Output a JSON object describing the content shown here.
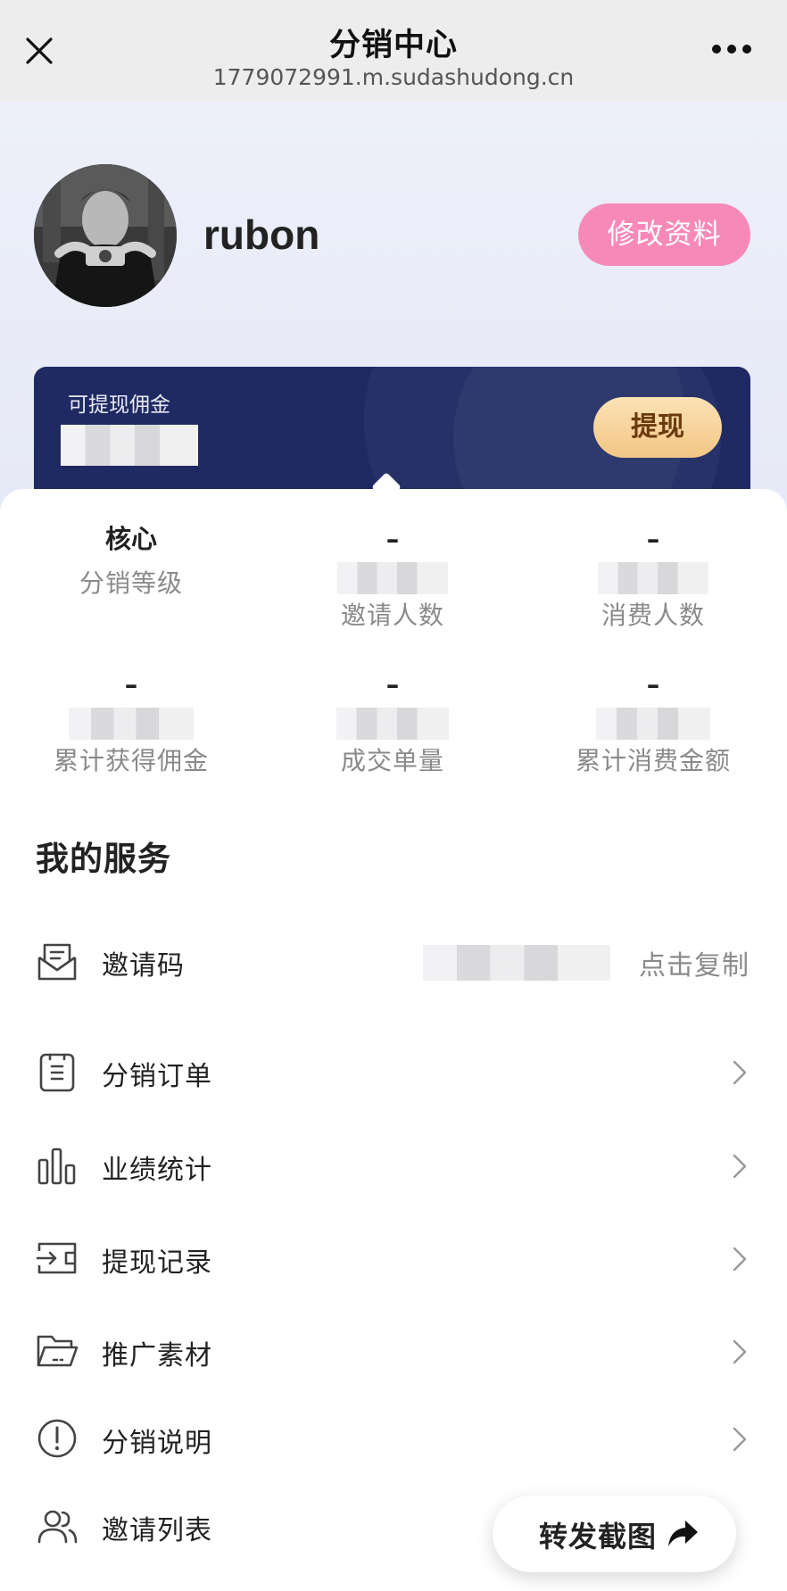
{
  "navbar": {
    "title": "分销中心",
    "url": "1779072991.m.sudashudong.cn"
  },
  "profile": {
    "username": "rubon",
    "edit_label": "修改资料"
  },
  "commission_card": {
    "label": "可提现佣金",
    "withdraw_label": "提现"
  },
  "stats": [
    {
      "value": "核心",
      "label": "分销等级"
    },
    {
      "value": "–",
      "label": "邀请人数"
    },
    {
      "value": "–",
      "label": "消费人数"
    },
    {
      "value": "–",
      "label": "累计获得佣金"
    },
    {
      "value": "–",
      "label": "成交单量"
    },
    {
      "value": "–",
      "label": "累计消费金额"
    }
  ],
  "services": {
    "title": "我的服务",
    "invite_code": {
      "label": "邀请码",
      "action": "点击复制",
      "icon": "mail-icon"
    },
    "items": [
      {
        "label": "分销订单",
        "icon": "order-icon"
      },
      {
        "label": "业绩统计",
        "icon": "bar-chart-icon"
      },
      {
        "label": "提现记录",
        "icon": "wallet-icon"
      },
      {
        "label": "推广素材",
        "icon": "folder-icon"
      },
      {
        "label": "分销说明",
        "icon": "info-icon"
      },
      {
        "label": "邀请列表",
        "icon": "users-icon"
      }
    ]
  },
  "share": {
    "label": "转发截图",
    "icon": "share-arrow-icon"
  },
  "colors": {
    "edit_button": "#f789b8",
    "card_bg": "#1f2a63",
    "withdraw_button": "#f3c685"
  }
}
